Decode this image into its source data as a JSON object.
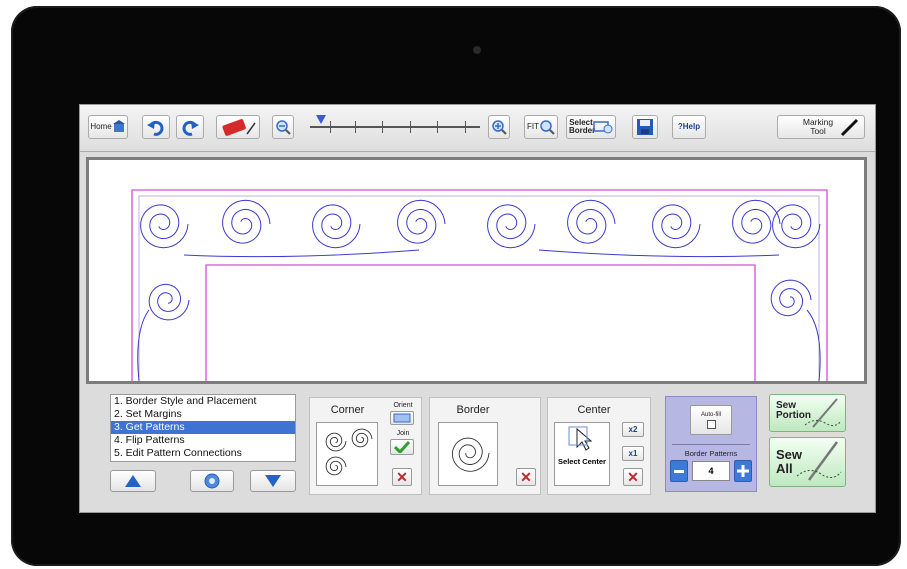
{
  "toolbar": {
    "home_label": "Home",
    "select_border_label": "Select Border",
    "help_label": "?Help",
    "marking_tool_label": "Marking Tool",
    "zoom_fit_label": "FIT"
  },
  "steps": {
    "items": [
      {
        "label": "1. Border Style and Placement"
      },
      {
        "label": "2. Set Margins"
      },
      {
        "label": "3. Get Patterns"
      },
      {
        "label": "4. Flip Patterns"
      },
      {
        "label": "5. Edit Pattern Connections"
      }
    ],
    "selected_index": 2
  },
  "corner": {
    "title": "Corner",
    "orient_label": "Orient",
    "join_label": "Join"
  },
  "border": {
    "title": "Border"
  },
  "center": {
    "title": "Center",
    "select_center_label": "Select Center",
    "x2_label": "x2",
    "x1_label": "x1"
  },
  "border_patterns": {
    "autofill_label": "Auto-fill",
    "title": "Border Patterns",
    "count": "4"
  },
  "sew": {
    "portion_label": "Sew Portion",
    "all_label": "Sew All"
  },
  "colors": {
    "accent_blue": "#3e73d3",
    "pattern_line": "#3a3ad0",
    "margin_line": "#d24fd2",
    "purple_panel": "#b7b7e3",
    "sew_green": "#bfe8c0"
  },
  "icons": [
    "home-icon",
    "undo-icon",
    "redo-icon",
    "eraser-icon",
    "zoom-out-icon",
    "zoom-in-icon",
    "zoom-fit-icon",
    "save-icon",
    "marking-pen-icon"
  ]
}
